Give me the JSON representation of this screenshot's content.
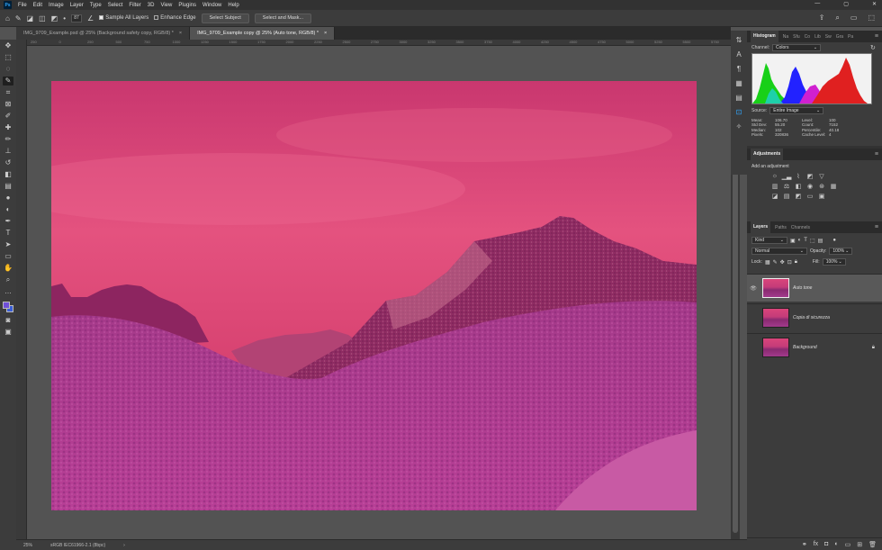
{
  "app": {
    "logo": "Ps"
  },
  "menu": [
    "File",
    "Edit",
    "Image",
    "Layer",
    "Type",
    "Select",
    "Filter",
    "3D",
    "View",
    "Plugins",
    "Window",
    "Help"
  ],
  "window_controls": {
    "minimize": "—",
    "maximize": "▢",
    "close": "✕"
  },
  "options": {
    "brush_size": "87",
    "sample_all_layers": "Sample All Layers",
    "enhance_edge": "Enhance Edge",
    "select_subject": "Select Subject",
    "select_and_mask": "Select and Mask..."
  },
  "tabs": [
    {
      "label": "IMG_9709_Example.psd @ 25% (Background safety copy, RGB/8) *",
      "close": "×"
    },
    {
      "label": "IMG_9709_Example copy @ 25% (Auto tone, RGB/8) *",
      "close": "×"
    }
  ],
  "status": {
    "zoom": "25%",
    "profile": "sRGB IEC61966-2.1 (8bpc)",
    "arrow": "›"
  },
  "histogram": {
    "tabs": [
      "Histogram",
      "Na",
      "Sfu",
      "Co",
      "Lib",
      "Sw",
      "Gra",
      "Pa"
    ],
    "channel_label": "Channel:",
    "channel_value": "Colors",
    "source_label": "Source:",
    "source_value": "Entire Image",
    "stats": [
      {
        "k": "Mean:",
        "v": "106.70",
        "k2": "Level:",
        "v2": "100"
      },
      {
        "k": "Std Dev:",
        "v": "55.20",
        "k2": "Count:",
        "v2": "7152"
      },
      {
        "k": "Median:",
        "v": "102",
        "k2": "Percentile:",
        "v2": "40.18"
      },
      {
        "k": "Pixels:",
        "v": "320836",
        "k2": "Cache Level:",
        "v2": "4"
      }
    ]
  },
  "adjustments": {
    "title": "Adjustments",
    "add_label": "Add an adjustment"
  },
  "layers": {
    "tabs": [
      "Layers",
      "Paths",
      "Channels"
    ],
    "filter": "Kind",
    "blend": "Normal",
    "opacity_label": "Opacity:",
    "opacity": "100%",
    "lock_label": "Lock:",
    "fill_label": "Fill:",
    "fill": "100%",
    "items": [
      {
        "name": "Auto tone",
        "visible": true,
        "active": true
      },
      {
        "name": "Copia di sicurezza",
        "visible": false,
        "active": false
      },
      {
        "name": "Background",
        "visible": false,
        "active": false,
        "locked": true
      }
    ]
  },
  "ruler_ticks": [
    "250",
    "0",
    "250",
    "500",
    "750",
    "1000",
    "1250",
    "1500",
    "1750",
    "2000",
    "2250",
    "2500",
    "2750",
    "3000",
    "3250",
    "3500",
    "3750",
    "4000",
    "4250",
    "4500",
    "4750",
    "5000",
    "5250",
    "5500",
    "5750"
  ],
  "colors": {
    "fg": "#6f4fd8",
    "bg": "#3a5ed6",
    "accent": "#31a8ff"
  }
}
